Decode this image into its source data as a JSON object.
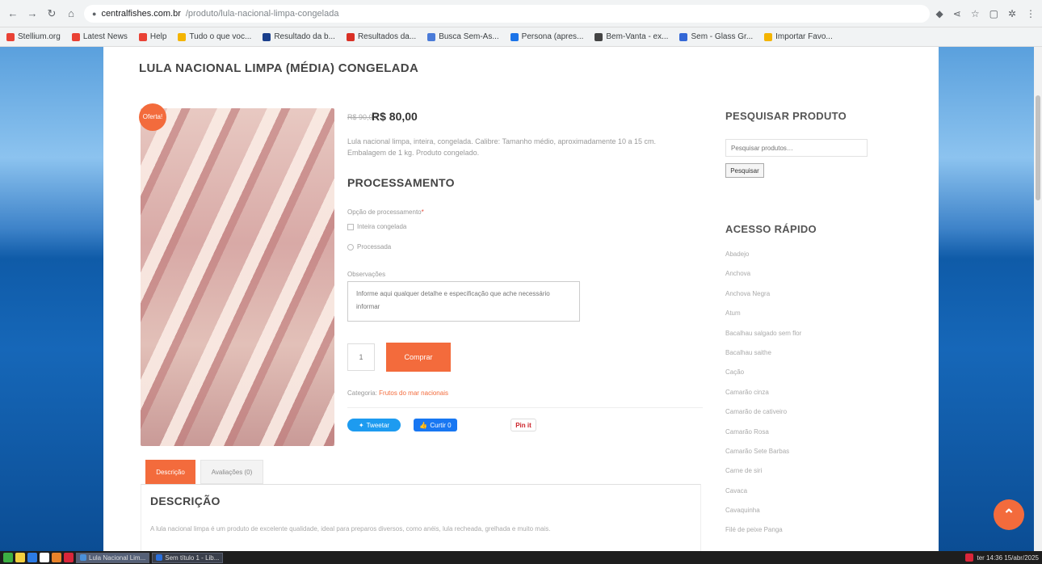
{
  "browser": {
    "url_host": "centralfishes.com.br",
    "url_path": "/produto/lula-nacional-limpa-congelada"
  },
  "bookmarks": [
    {
      "label": "Stellium.org",
      "color": "#e94235"
    },
    {
      "label": "Latest News",
      "color": "#e94235"
    },
    {
      "label": "Help",
      "color": "#e94235"
    },
    {
      "label": "Tudo o que voc...",
      "color": "#f4b400"
    },
    {
      "label": "Resultado da b...",
      "color": "#1a3f8c"
    },
    {
      "label": "Resultados da...",
      "color": "#d93025"
    },
    {
      "label": "Busca Sem-As...",
      "color": "#4a7bd8"
    },
    {
      "label": "Persona (apres...",
      "color": "#1a73e8"
    },
    {
      "label": "Bem-Vanta - ex...",
      "color": "#444444"
    },
    {
      "label": "Sem - Glass Gr...",
      "color": "#3367d6"
    },
    {
      "label": "Importar Favo...",
      "color": "#f4b400"
    }
  ],
  "product": {
    "title": "LULA NACIONAL LIMPA (MÉDIA) CONGELADA",
    "sale_badge": "Oferta!",
    "price_old": "R$ 90,00",
    "price_new": "R$ 80,00",
    "short_desc": "Lula nacional limpa, inteira, congelada. Calibre: Tamanho médio, aproximadamente 10 a 15 cm. Embalagem de 1 kg. Produto congelado.",
    "process_heading": "PROCESSAMENTO",
    "option_label": "Opção de processamento",
    "option_required": "*",
    "options": [
      "Inteira congelada",
      "Processada"
    ],
    "obs_label": "Observações",
    "obs_placeholder": "Informe aqui qualquer detalhe e especificação que ache necessário informar",
    "qty": "1",
    "buy_label": "Comprar",
    "category_prefix": "Categoria:",
    "category_link": "Frutos do mar nacionais",
    "share_tw": "Tweetar",
    "share_fb": "Curtir 0",
    "share_pin": "Pin it"
  },
  "tabs": {
    "description": "Descrição",
    "reviews": "Avaliações (0)"
  },
  "description": {
    "title": "DESCRIÇÃO",
    "text": "A lula nacional limpa é um produto de excelente qualidade, ideal para preparos diversos, como anéis, lula recheada, grelhada e muito mais."
  },
  "sidebar": {
    "search_title": "PESQUISAR PRODUTO",
    "search_placeholder": "Pesquisar produtos…",
    "search_button": "Pesquisar",
    "quick_title": "ACESSO RÁPIDO",
    "quick_items": [
      "Abadejo",
      "Anchova",
      "Anchova Negra",
      "Atum",
      "Bacalhau salgado sem flor",
      "Bacalhau saithe",
      "Cação",
      "Camarão cinza",
      "Camarão de cativeiro",
      "Camarão Rosa",
      "Camarão Sete Barbas",
      "Carne de siri",
      "Cavaca",
      "Cavaquinha",
      "Filé de peixe Panga"
    ]
  },
  "taskbar": {
    "windows": [
      "Lula Nacional Lim...",
      "Sem título 1 - Lib..."
    ],
    "clock": "ter 14:36 15/abr/2025"
  }
}
